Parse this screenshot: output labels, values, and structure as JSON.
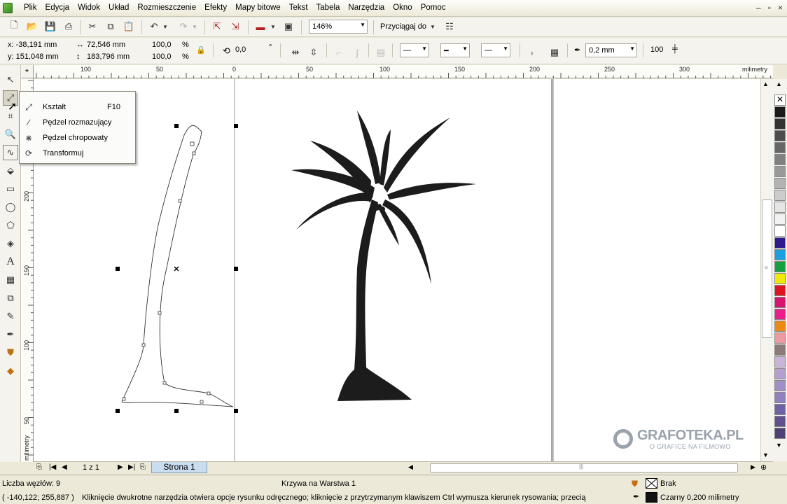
{
  "menubar": {
    "items": [
      "Plik",
      "Edycja",
      "Widok",
      "Układ",
      "Rozmieszczenie",
      "Efekty",
      "Mapy bitowe",
      "Tekst",
      "Tabela",
      "Narzędzia",
      "Okno",
      "Pomoc"
    ],
    "window_buttons": [
      "–",
      "▫",
      "×"
    ]
  },
  "toolbar": {
    "zoom": "146%",
    "snap_label": "Przyciągaj do"
  },
  "propbar": {
    "x": "x:  -38,191 mm",
    "y": "y:  151,048 mm",
    "width": "72,546 mm",
    "height": "183,796 mm",
    "scale_w": "100,0",
    "scale_h": "100,0",
    "percent": "%",
    "rotation": "0,0",
    "degree": "°",
    "outline_width": "0,2 mm",
    "smoothing": "100"
  },
  "rulers": {
    "unit": "milimetry",
    "h_ticks": [
      "100",
      "50",
      "0",
      "50",
      "100",
      "150",
      "200",
      "250",
      "300"
    ],
    "v_ticks": [
      "200",
      "150",
      "100",
      "50"
    ],
    "v_unit": "milimetry"
  },
  "flyout": {
    "items": [
      {
        "label": "Kształt",
        "shortcut": "F10",
        "icon": "shape-tool-icon"
      },
      {
        "label": "Pędzel rozmazujący",
        "shortcut": "",
        "icon": "smudge-brush-icon"
      },
      {
        "label": "Pędzel chropowaty",
        "shortcut": "",
        "icon": "roughen-brush-icon"
      },
      {
        "label": "Transformuj",
        "shortcut": "",
        "icon": "free-transform-icon"
      }
    ]
  },
  "pages": {
    "nav": "1 z 1",
    "tab": "Strona 1"
  },
  "watermark": {
    "brand": "GRAFOTEKA.PL",
    "tagline": "O GRAFICE NA FILMOWO"
  },
  "status": {
    "nodes": "Liczba węzłów: 9",
    "object": "Krzywa na Warstwa 1",
    "coords": "( -140,122; 255,887 )",
    "hint": "Kliknięcie dwukrotne narzędzia otwiera opcje rysunku odręcznego; kliknięcie z przytrzymanym klawiszem Ctrl wymusza kierunek rysowania; przeciąg...",
    "fill": "Brak",
    "outline": "Czarny  0,200 milimetry"
  },
  "palette": {
    "colors": [
      "#ffffff",
      "#1a1a1a",
      "#333333",
      "#4d4d4d",
      "#666666",
      "#808080",
      "#999999",
      "#b3b3b3",
      "#cccccc",
      "#e6e6e6",
      "#f2f2f2",
      "#ffffff",
      "#2e1a8c",
      "#1aa0e0",
      "#13a040",
      "#f0e800",
      "#e0141e",
      "#d81470",
      "#ec1c8c",
      "#ec8814",
      "#ec9aa0",
      "#8c7a78",
      "#c8b4d8",
      "#b4a0d0",
      "#a090c8",
      "#9080c0",
      "#7060a8",
      "#605090",
      "#504078"
    ]
  }
}
